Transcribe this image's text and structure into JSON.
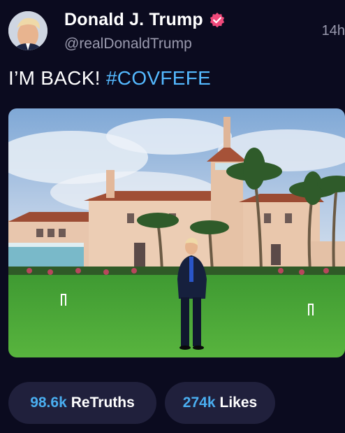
{
  "author": {
    "display_name": "Donald J. Trump",
    "handle": "@realDonaldTrump",
    "verified": true,
    "verified_color": "#f04a7b"
  },
  "post": {
    "timestamp": "14h",
    "text": "I’M BACK!",
    "hashtag": "#COVFEFE",
    "hashtag_color": "#54b9ff"
  },
  "stats": {
    "retruths_value": "98.6k",
    "retruths_label": "ReTruths",
    "likes_value": "274k",
    "likes_label": "Likes",
    "value_color": "#4aaef0"
  }
}
